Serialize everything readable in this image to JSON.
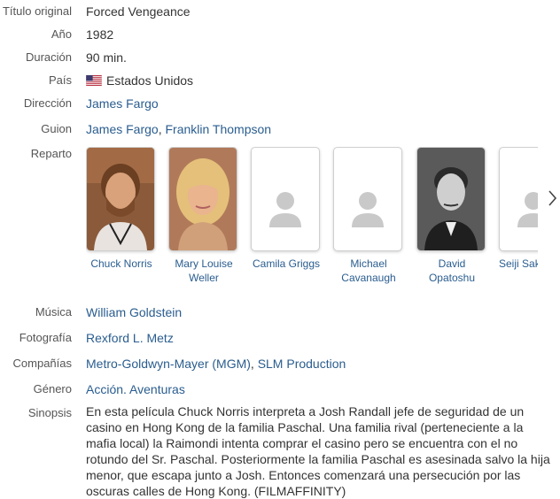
{
  "labels": {
    "original_title": "Título original",
    "year": "Año",
    "duration": "Duración",
    "country": "País",
    "direction": "Dirección",
    "script": "Guion",
    "cast": "Reparto",
    "music": "Música",
    "photography": "Fotografía",
    "companies": "Compañías",
    "genre": "Género",
    "synopsis": "Sinopsis"
  },
  "values": {
    "original_title": "Forced Vengeance",
    "year": "1982",
    "duration": "90 min.",
    "country": "Estados Unidos",
    "direction": "James Fargo",
    "script": [
      "James Fargo",
      "Franklin Thompson"
    ],
    "music": "William Goldstein",
    "photography": "Rexford L. Metz",
    "companies": [
      "Metro-Goldwyn-Mayer (MGM)",
      "SLM Production"
    ],
    "genre": [
      "Acción",
      "Aventuras"
    ],
    "synopsis": "En esta película Chuck Norris interpreta a Josh Randall jefe de seguridad de un casino en Hong Kong de la familia Paschal. Una familia rival (perteneciente a la mafia local) la Raimondi intenta comprar el casino pero se encuentra con el no rotundo del Sr. Paschal. Posteriormente la familia Paschal es asesinada salvo la hija menor, que escapa junto a Josh. Entonces comenzará una persecución por las oscuras calles de Hong Kong. (FILMAFFINITY)"
  },
  "cast": [
    {
      "name": "Chuck Norris",
      "photo": "photo"
    },
    {
      "name": "Mary Louise Weller",
      "photo": "photo"
    },
    {
      "name": "Camila Griggs",
      "photo": "placeholder"
    },
    {
      "name": "Michael Cavanaugh",
      "photo": "placeholder"
    },
    {
      "name": "David Opatoshu",
      "photo": "photo"
    },
    {
      "name": "Seiji Sakaguchi",
      "photo": "placeholder"
    }
  ],
  "separators": {
    "comma": ", ",
    "genre_sep": ". "
  },
  "icons": {
    "country_flag": "us-flag-icon",
    "next": "chevron-right-icon",
    "placeholder": "person-placeholder-icon"
  },
  "colors": {
    "link": "#2a5d8f",
    "label": "#555555",
    "text": "#333333"
  }
}
